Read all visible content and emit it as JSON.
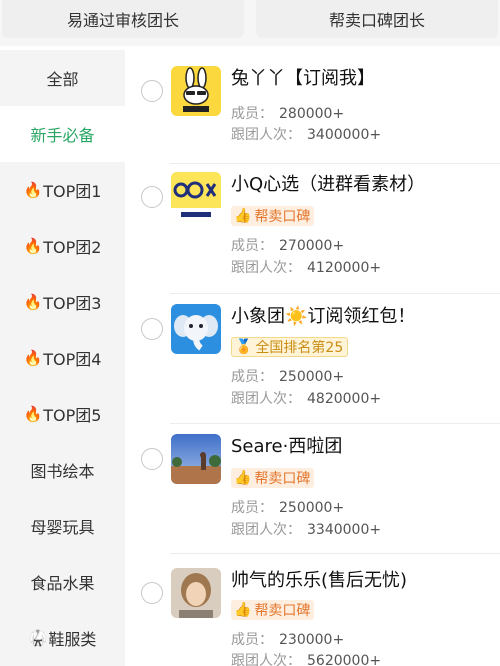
{
  "top_tabs": [
    {
      "label": "易通过审核团长"
    },
    {
      "label": "帮卖口碑团长"
    }
  ],
  "sidebar": {
    "items": [
      {
        "label": "全部"
      },
      {
        "label": "新手必备",
        "active": true
      },
      {
        "label": "TOP团1",
        "icon": "fire-icon"
      },
      {
        "label": "TOP团2",
        "icon": "fire-icon"
      },
      {
        "label": "TOP团3",
        "icon": "fire-icon"
      },
      {
        "label": "TOP团4",
        "icon": "fire-icon"
      },
      {
        "label": "TOP团5",
        "icon": "fire-icon"
      },
      {
        "label": "图书绘本"
      },
      {
        "label": "母婴玩具"
      },
      {
        "label": "食品水果"
      },
      {
        "label": "鞋服类",
        "icon": "uniform-icon"
      }
    ]
  },
  "labels": {
    "members": "成员：",
    "follows": "跟团人次："
  },
  "groups": [
    {
      "name": "兔丫丫【订阅我】",
      "avatar": "rabbit-logo",
      "members": "280000+",
      "follows": "3400000+",
      "badge": null
    },
    {
      "name": "小Q心选（进群看素材）",
      "avatar": "xiaoq-logo",
      "members": "270000+",
      "follows": "4120000+",
      "badge": {
        "type": "praise",
        "text": "帮卖口碑"
      }
    },
    {
      "name": "小象团☀️订阅领红包！",
      "avatar": "elephant-logo",
      "members": "250000+",
      "follows": "4820000+",
      "badge": {
        "type": "rank",
        "text": "全国排名第25"
      }
    },
    {
      "name": "Seare·西啦团",
      "avatar": "landscape-photo",
      "members": "250000+",
      "follows": "3340000+",
      "badge": {
        "type": "praise",
        "text": "帮卖口碑"
      }
    },
    {
      "name": "帅气的乐乐(售后无忧)",
      "avatar": "portrait-photo",
      "members": "230000+",
      "follows": "5620000+",
      "badge": {
        "type": "praise",
        "text": "帮卖口碑"
      }
    }
  ],
  "colors": {
    "accent_green": "#2aa764",
    "praise_orange": "#e4762c",
    "rank_gold": "#c98d12"
  }
}
